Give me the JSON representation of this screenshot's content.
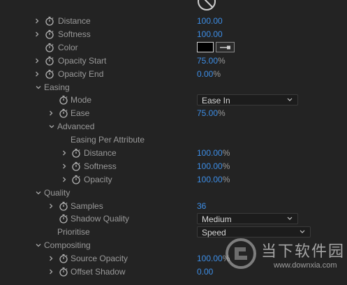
{
  "rows": {
    "distance": {
      "label": "Distance",
      "value": "100.00"
    },
    "softness": {
      "label": "Softness",
      "value": "100.00"
    },
    "color": {
      "label": "Color"
    },
    "opacity_start": {
      "label": "Opacity Start",
      "value": "75.00",
      "unit": "%"
    },
    "opacity_end": {
      "label": "Opacity End",
      "value": "0.00",
      "unit": "%"
    },
    "easing": {
      "label": "Easing"
    },
    "mode": {
      "label": "Mode",
      "value": "Ease In"
    },
    "ease": {
      "label": "Ease",
      "value": "75.00",
      "unit": "%"
    },
    "advanced": {
      "label": "Advanced"
    },
    "easing_per_attribute": {
      "label": "Easing Per Attribute"
    },
    "epa_distance": {
      "label": "Distance",
      "value": "100.00",
      "unit": "%"
    },
    "epa_softness": {
      "label": "Softness",
      "value": "100.00",
      "unit": "%"
    },
    "epa_opacity": {
      "label": "Opacity",
      "value": "100.00",
      "unit": "%"
    },
    "quality": {
      "label": "Quality"
    },
    "samples": {
      "label": "Samples",
      "value": "36"
    },
    "shadow_quality": {
      "label": "Shadow Quality",
      "value": "Medium"
    },
    "prioritise": {
      "label": "Prioritise",
      "value": "Speed"
    },
    "compositing": {
      "label": "Compositing"
    },
    "source_opacity": {
      "label": "Source Opacity",
      "value": "100.00",
      "unit": "%"
    },
    "offset_shadow": {
      "label": "Offset Shadow",
      "value": "0.00"
    }
  },
  "colors": {
    "background": "#232323",
    "label": "#9a9a9a",
    "value_blue": "#3d8ee6",
    "swatch": "#000000"
  },
  "watermark": {
    "title": "当下软件园",
    "url": "www.downxia.com"
  },
  "icons": {
    "stopwatch": "stopwatch-icon",
    "chevron_right": "chevron-right-icon",
    "chevron_down": "chevron-down-icon",
    "eyedropper": "eyedropper-icon",
    "reset": "reset-icon"
  }
}
